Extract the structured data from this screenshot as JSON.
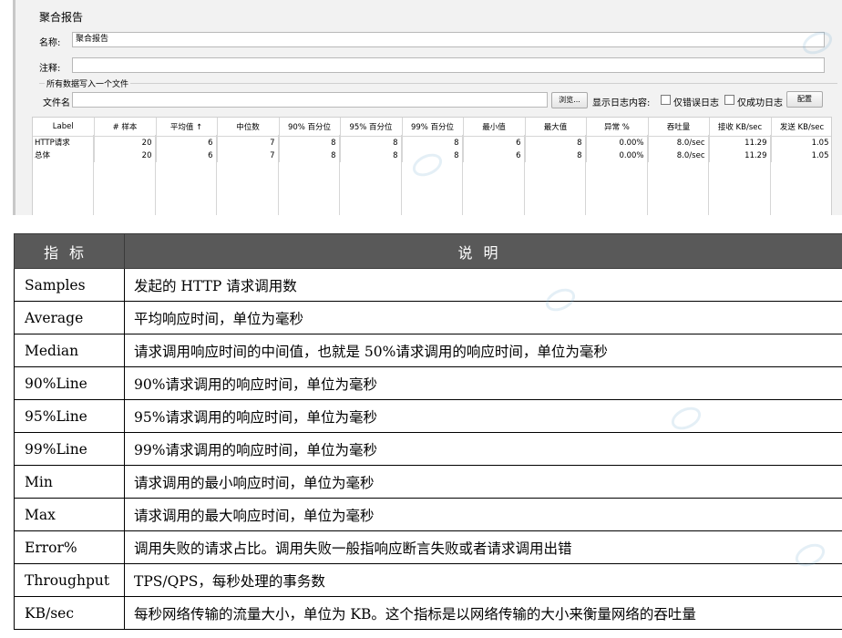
{
  "panel": {
    "title": "聚合报告",
    "name_label": "名称:",
    "name_value": "聚合报告",
    "comment_label": "注释:",
    "comment_value": "",
    "file_group_title": "所有数据写入一个文件",
    "filename_label": "文件名",
    "filename_value": "",
    "browse_button": "浏览...",
    "log_content_label": "显示日志内容:",
    "errors_only_label": "仅错误日志",
    "success_only_label": "仅成功日志",
    "configure_button": "配置"
  },
  "results": {
    "headers": [
      "Label",
      "# 样本",
      "平均值 ↑",
      "中位数",
      "90% 百分位",
      "95% 百分位",
      "99% 百分位",
      "最小值",
      "最大值",
      "异常 %",
      "吞吐量",
      "接收 KB/sec",
      "发送 KB/sec"
    ],
    "rows": [
      [
        "HTTP请求",
        "20",
        "6",
        "7",
        "8",
        "8",
        "8",
        "6",
        "8",
        "0.00%",
        "8.0/sec",
        "11.29",
        "1.05"
      ],
      [
        "总体",
        "20",
        "6",
        "7",
        "8",
        "8",
        "8",
        "6",
        "8",
        "0.00%",
        "8.0/sec",
        "11.29",
        "1.05"
      ]
    ]
  },
  "metrics": {
    "header_metric": "指标",
    "header_desc": "说明",
    "rows": [
      {
        "name": "Samples",
        "desc": "发起的 HTTP 请求调用数"
      },
      {
        "name": "Average",
        "desc": "平均响应时间，单位为毫秒"
      },
      {
        "name": "Median",
        "desc": "请求调用响应时间的中间值，也就是 50%请求调用的响应时间，单位为毫秒"
      },
      {
        "name": "90%Line",
        "desc": "90%请求调用的响应时间，单位为毫秒"
      },
      {
        "name": "95%Line",
        "desc": "95%请求调用的响应时间，单位为毫秒"
      },
      {
        "name": "99%Line",
        "desc": "99%请求调用的响应时间，单位为毫秒"
      },
      {
        "name": "Min",
        "desc": "请求调用的最小响应时间，单位为毫秒"
      },
      {
        "name": "Max",
        "desc": "请求调用的最大响应时间，单位为毫秒"
      },
      {
        "name": "Error%",
        "desc": "调用失败的请求占比。调用失败一般指响应断言失败或者请求调用出错"
      },
      {
        "name": "Throughput",
        "desc": "TPS/QPS，每秒处理的事务数"
      },
      {
        "name": "KB/sec",
        "desc": "每秒网络传输的流量大小，单位为 KB。这个指标是以网络传输的大小来衡量网络的吞吐量"
      }
    ]
  },
  "colors": {
    "panel_bg": "#f2f2f2",
    "header_bg": "#595959",
    "header_text": "#ffffff",
    "watermark": "#78afd2"
  }
}
